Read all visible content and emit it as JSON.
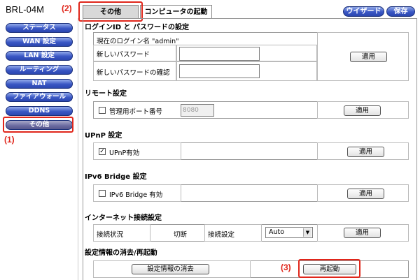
{
  "header": {
    "model": "BRL-04M",
    "tabs": [
      {
        "label": "その他"
      },
      {
        "label": "コンピュータの起動"
      }
    ],
    "wizard_label": "ウイザード",
    "save_label": "保存"
  },
  "callouts": {
    "c1": "(1)",
    "c2": "(2)",
    "c3": "(3)"
  },
  "sidebar": {
    "items": [
      {
        "label": "ステータス"
      },
      {
        "label": "WAN 設定"
      },
      {
        "label": "LAN 設定"
      },
      {
        "label": "ルーティング"
      },
      {
        "label": "NAT"
      },
      {
        "label": "ファイアウォール"
      },
      {
        "label": "DDNS"
      },
      {
        "label": "その他"
      }
    ]
  },
  "login": {
    "title": "ログインID と パスワードの設定",
    "current_login": "現在のログイン名 \"admin\"",
    "new_password_label": "新しいパスワード",
    "confirm_password_label": "新しいパスワードの確認",
    "new_password_value": "",
    "confirm_password_value": "",
    "apply_label": "適用"
  },
  "remote": {
    "title": "リモート設定",
    "port_label": "管理用ポート番号",
    "port_value": "8080",
    "port_checked": false,
    "apply_label": "適用"
  },
  "upnp": {
    "title": "UPnP 設定",
    "enable_label": "UPnP有効",
    "enabled": true,
    "check_mark": "✓",
    "apply_label": "適用"
  },
  "ipv6": {
    "title": "IPv6 Bridge 設定",
    "enable_label": "IPv6 Bridge 有効",
    "enabled": false,
    "apply_label": "適用"
  },
  "internet": {
    "title": "インターネット接続設定",
    "status_label": "接続状況",
    "status_value": "切断",
    "setting_label": "接続設定",
    "setting_value": "Auto",
    "apply_label": "適用"
  },
  "reset": {
    "title": "設定情報の消去/再起動",
    "clear_label": "設定情報の消去",
    "restart_label": "再起動"
  },
  "colors": {
    "accent": "#e0261b",
    "nav_blue": "#3a57c4"
  }
}
